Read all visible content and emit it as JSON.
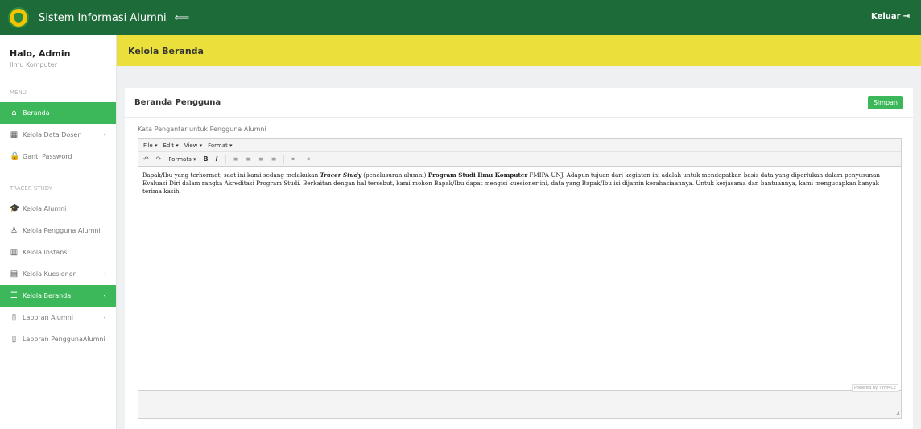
{
  "topbar": {
    "app_title": "Sistem Informasi Alumni",
    "menu_toggle": "⟸",
    "logout_label": "Keluar",
    "logout_icon": "⇥"
  },
  "sidebar": {
    "greeting": "Halo, Admin",
    "department": "Ilmu Komputer",
    "section_menu": "MENU",
    "section_tracer": "TRACER STUDY",
    "items": [
      {
        "label": "Beranda",
        "icon": "⌂",
        "chev": ""
      },
      {
        "label": "Kelola Data Dosen",
        "icon": "▦",
        "chev": "‹"
      },
      {
        "label": "Ganti Password",
        "icon": "🔒",
        "chev": ""
      },
      {
        "label": "Kelola Alumni",
        "icon": "🎓",
        "chev": ""
      },
      {
        "label": "Kelola Pengguna Alumni",
        "icon": "♙",
        "chev": ""
      },
      {
        "label": "Kelola Instansi",
        "icon": "▥",
        "chev": ""
      },
      {
        "label": "Kelola Kuesioner",
        "icon": "▤",
        "chev": "‹"
      },
      {
        "label": "Kelola Beranda",
        "icon": "☰",
        "chev": "‹"
      },
      {
        "label": "Laporan Alumni",
        "icon": "▯",
        "chev": "‹"
      },
      {
        "label": "Laporan PenggunaAlumni",
        "icon": "▯",
        "chev": ""
      }
    ]
  },
  "header": {
    "title": "Kelola Beranda"
  },
  "card": {
    "title": "Beranda Pengguna",
    "save_label": "Simpan",
    "field_label": "Kata Pengantar untuk Pengguna Alumni"
  },
  "editor": {
    "menu": [
      "File ▾",
      "Edit ▾",
      "View ▾",
      "Format ▾"
    ],
    "undo": "↶",
    "redo": "↷",
    "formats": "Formats ▾",
    "bold": "B",
    "italic": "I",
    "align_left": "≡",
    "align_center": "≡",
    "align_right": "≡",
    "align_justify": "≡",
    "outdent": "⇤",
    "indent": "⇥",
    "content_part1": "Bapak/Ibu yang terhormat, saat ini kami sedang melakukan ",
    "content_italic": "Tracer Study",
    "content_part2": " (penelusuran alumni) ",
    "content_bold": "Program Studi Ilmu Komputer",
    "content_part3": " FMIPA-UNJ. Adapun tujuan dari kegiatan ini adalah untuk mendapatkan basis data yang diperlukan dalam penyusunan Evaluasi Diri dalam rangka Akreditasi Program Studi. Berkaitan dengan hal tersebut, kami mohon Bapak/Ibu dapat mengisi kuesioner ini, data yang Bapak/Ibu isi dijamin kerahasiaannya. Untuk kerjasama dan bantuannya, kami mengucapkan banyak terima kasih.",
    "powered_by": "Powered by TinyMCE",
    "resize_handle": "◢"
  },
  "colors": {
    "topbar": "#1e6b3a",
    "accent_green": "#3cb85a",
    "header_yellow": "#ebdf3c"
  }
}
